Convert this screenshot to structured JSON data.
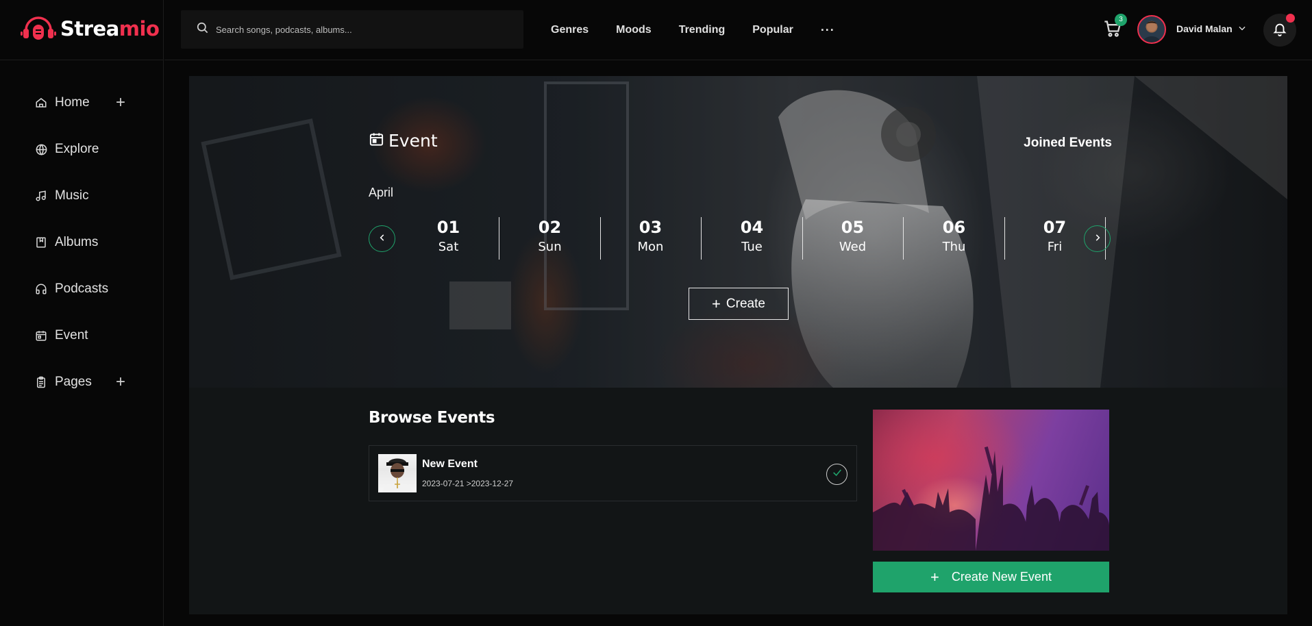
{
  "app": {
    "name_primary": "Strea",
    "name_accent": "mio"
  },
  "search": {
    "placeholder": "Search songs, podcasts, albums..."
  },
  "topnav": [
    "Genres",
    "Moods",
    "Trending",
    "Popular"
  ],
  "topnav_more": "···",
  "cart": {
    "count": "3"
  },
  "user": {
    "name": "David Malan"
  },
  "sidebar": {
    "items": [
      {
        "label": "Home",
        "icon": "home-icon",
        "has_plus": true
      },
      {
        "label": "Explore",
        "icon": "globe-icon",
        "has_plus": false
      },
      {
        "label": "Music",
        "icon": "music-note-icon",
        "has_plus": false
      },
      {
        "label": "Albums",
        "icon": "album-icon",
        "has_plus": false
      },
      {
        "label": "Podcasts",
        "icon": "headphones-icon",
        "has_plus": false
      },
      {
        "label": "Event",
        "icon": "calendar-icon",
        "has_plus": false
      },
      {
        "label": "Pages",
        "icon": "clipboard-icon",
        "has_plus": true
      }
    ]
  },
  "hero": {
    "title": "Event",
    "joined_label": "Joined Events",
    "month": "April",
    "days": [
      {
        "num": "01",
        "name": "Sat"
      },
      {
        "num": "02",
        "name": "Sun"
      },
      {
        "num": "03",
        "name": "Mon"
      },
      {
        "num": "04",
        "name": "Tue"
      },
      {
        "num": "05",
        "name": "Wed"
      },
      {
        "num": "06",
        "name": "Thu"
      },
      {
        "num": "07",
        "name": "Fri"
      }
    ],
    "create_label": "Create"
  },
  "browse": {
    "title": "Browse Events",
    "events": [
      {
        "name": "New Event",
        "dates": "2023-07-21 >2023-12-27",
        "joined": true
      }
    ],
    "create_new_label": "Create New Event"
  },
  "colors": {
    "accent": "#f0304e",
    "green": "#1fa36b",
    "background": "#070707"
  }
}
